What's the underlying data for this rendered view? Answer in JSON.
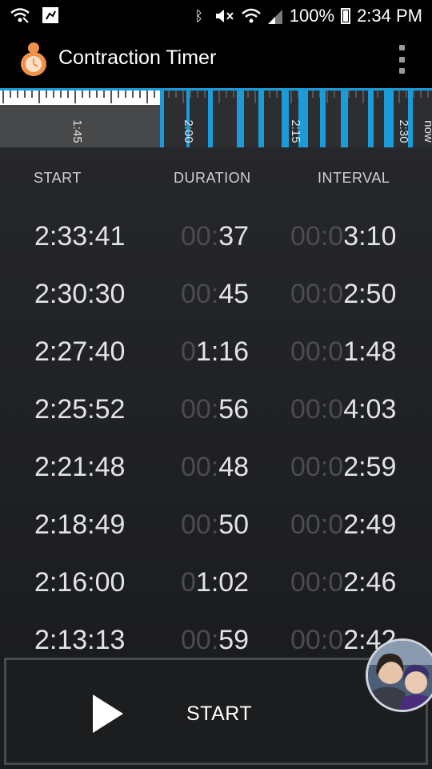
{
  "status_bar": {
    "battery_percent": "100%",
    "time": "2:34 PM"
  },
  "app": {
    "title": "Contraction Timer"
  },
  "timeline": {
    "labels": [
      "1:45",
      "2:00",
      "2:15",
      "2:30",
      "now"
    ],
    "accent_color": "#1b9bd8"
  },
  "table": {
    "headers": {
      "start": "START",
      "duration": "DURATION",
      "interval": "INTERVAL"
    },
    "rows": [
      {
        "start": "2:33:41",
        "duration_dim": "00:",
        "duration": "37",
        "interval_dim": "00:0",
        "interval": "3:10"
      },
      {
        "start": "2:30:30",
        "duration_dim": "00:",
        "duration": "45",
        "interval_dim": "00:0",
        "interval": "2:50"
      },
      {
        "start": "2:27:40",
        "duration_dim": "0",
        "duration": "1:16",
        "interval_dim": "00:0",
        "interval": "1:48"
      },
      {
        "start": "2:25:52",
        "duration_dim": "00:",
        "duration": "56",
        "interval_dim": "00:0",
        "interval": "4:03"
      },
      {
        "start": "2:21:48",
        "duration_dim": "00:",
        "duration": "48",
        "interval_dim": "00:0",
        "interval": "2:59"
      },
      {
        "start": "2:18:49",
        "duration_dim": "00:",
        "duration": "50",
        "interval_dim": "00:0",
        "interval": "2:49"
      },
      {
        "start": "2:16:00",
        "duration_dim": "0",
        "duration": "1:02",
        "interval_dim": "00:0",
        "interval": "2:46"
      },
      {
        "start": "2:13:13",
        "duration_dim": "00:",
        "duration": "59",
        "interval_dim": "00:0",
        "interval": "2:42"
      }
    ]
  },
  "start_button": {
    "label": "START",
    "icon": "play-icon"
  },
  "chat_head": {
    "icon": "avatar"
  }
}
